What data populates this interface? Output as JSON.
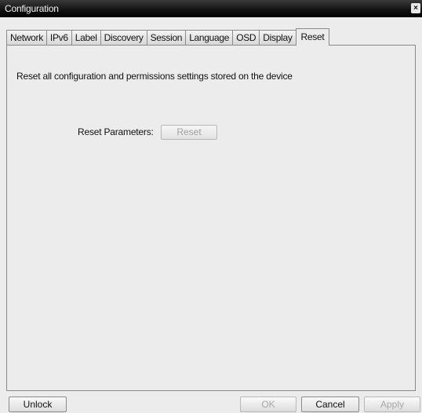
{
  "window": {
    "title": "Configuration",
    "close_label": "×"
  },
  "tabs": [
    {
      "label": "Network"
    },
    {
      "label": "IPv6"
    },
    {
      "label": "Label"
    },
    {
      "label": "Discovery"
    },
    {
      "label": "Session"
    },
    {
      "label": "Language"
    },
    {
      "label": "OSD"
    },
    {
      "label": "Display"
    },
    {
      "label": "Reset",
      "active": true
    }
  ],
  "reset_panel": {
    "description": "Reset all configuration and permissions settings stored on the device",
    "parameters_label": "Reset Parameters:",
    "reset_button_label": "Reset"
  },
  "footer": {
    "unlock_label": "Unlock",
    "ok_label": "OK",
    "cancel_label": "Cancel",
    "apply_label": "Apply"
  }
}
